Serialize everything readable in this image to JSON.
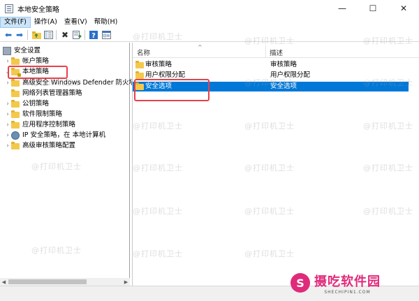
{
  "window": {
    "title": "本地安全策略"
  },
  "menu": [
    {
      "label": "文件(F)"
    },
    {
      "label": "操作(A)"
    },
    {
      "label": "查看(V)"
    },
    {
      "label": "帮助(H)"
    }
  ],
  "toolbar": {
    "icons": [
      "back-arrow-icon",
      "forward-arrow-icon",
      "up-folder-icon",
      "show-hide-tree-icon",
      "delete-icon",
      "export-list-icon",
      "help-icon",
      "properties-icon"
    ]
  },
  "tree": {
    "root": "安全设置",
    "items": [
      {
        "label": "帐户策略"
      },
      {
        "label": "本地策略"
      },
      {
        "label": "高级安全 Windows Defender 防火墙"
      },
      {
        "label": "网络列表管理器策略"
      },
      {
        "label": "公钥策略"
      },
      {
        "label": "软件限制策略"
      },
      {
        "label": "应用程序控制策略"
      },
      {
        "label": "IP 安全策略，在 本地计算机"
      },
      {
        "label": "高级审核策略配置"
      }
    ]
  },
  "list": {
    "columns": [
      "名称",
      "描述"
    ],
    "rows": [
      {
        "name": "审核策略",
        "desc": "审核策略"
      },
      {
        "name": "用户权限分配",
        "desc": "用户权限分配"
      },
      {
        "name": "安全选项",
        "desc": "安全选项"
      }
    ],
    "selected_index": 2
  },
  "watermark": {
    "text": "@打印机卫士"
  },
  "brand": {
    "name": "摄吃软件园",
    "url": "SHECHIPIN1.COM",
    "logo_glyph": "S"
  },
  "colors": {
    "selection": "#0078d7",
    "highlight_box": "#e8404a",
    "brand": "#e02a7a"
  }
}
